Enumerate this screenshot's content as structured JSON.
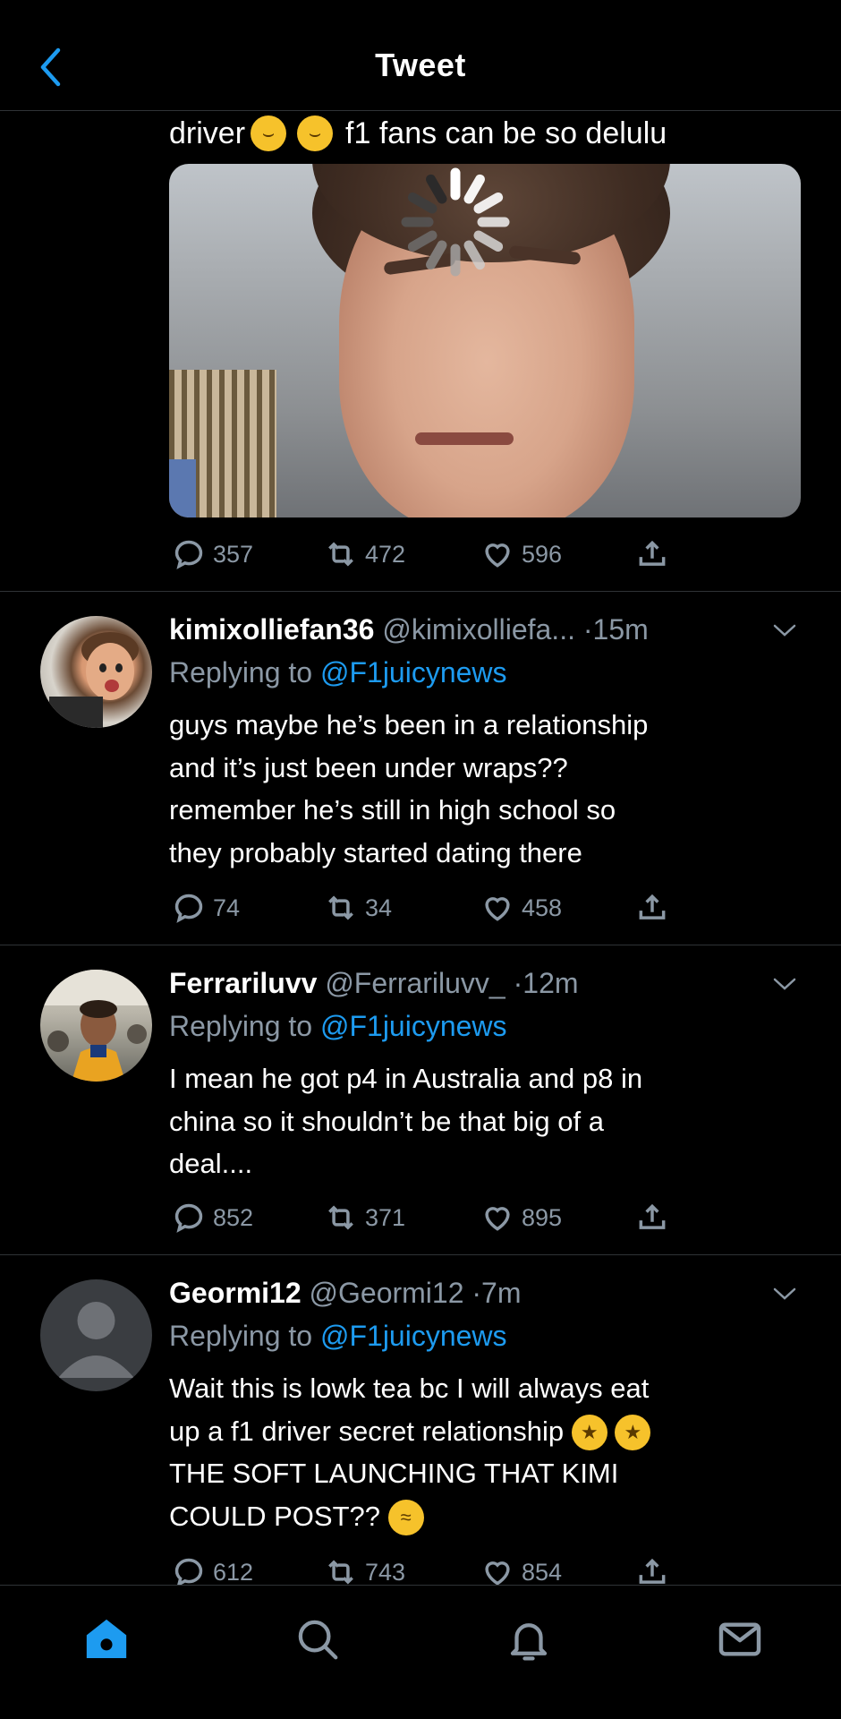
{
  "header": {
    "title": "Tweet"
  },
  "tweet": {
    "text_before": "driver",
    "text_after": "f1 fans can be so delulu",
    "emoji": "crying-face",
    "stats": {
      "replies": "357",
      "retweets": "472",
      "likes": "596"
    }
  },
  "replies": [
    {
      "name": "kimixolliefan36",
      "handle": "@kimixolliefa...",
      "time": "·15m",
      "replying_prefix": "Replying to",
      "replying_to": "@F1juicynews",
      "lines": [
        "guys maybe he’s been in a relationship",
        "and it’s just been under wraps??",
        "remember he’s still in high school so",
        "they probably started dating there"
      ],
      "stats": {
        "replies": "74",
        "retweets": "34",
        "likes": "458"
      }
    },
    {
      "name": "Ferrariluvv",
      "handle": "@Ferrariluvv_",
      "time": "·12m",
      "replying_prefix": "Replying to",
      "replying_to": "@F1juicynews",
      "lines": [
        "I mean he got p4 in Australia and p8 in",
        "china so it shouldn’t be that big of a",
        "deal...."
      ],
      "stats": {
        "replies": "852",
        "retweets": "371",
        "likes": "895"
      }
    },
    {
      "name": "Geormi12",
      "handle": "@Geormi12",
      "time": "·7m",
      "replying_prefix": "Replying to",
      "replying_to": "@F1juicynews",
      "lines": [
        "Wait this is lowk tea bc I will always eat",
        "up a f1 driver secret relationship",
        "THE SOFT LAUNCHING THAT KIMI",
        "COULD POST??"
      ],
      "stats": {
        "replies": "612",
        "retweets": "743",
        "likes": "854"
      }
    }
  ],
  "colors": {
    "accent": "#1d9bf0",
    "muted": "#8b98a5",
    "divider": "#2f3336",
    "background": "#000000"
  },
  "tabs": [
    "home-icon",
    "search-icon",
    "notifications-icon",
    "messages-icon"
  ]
}
